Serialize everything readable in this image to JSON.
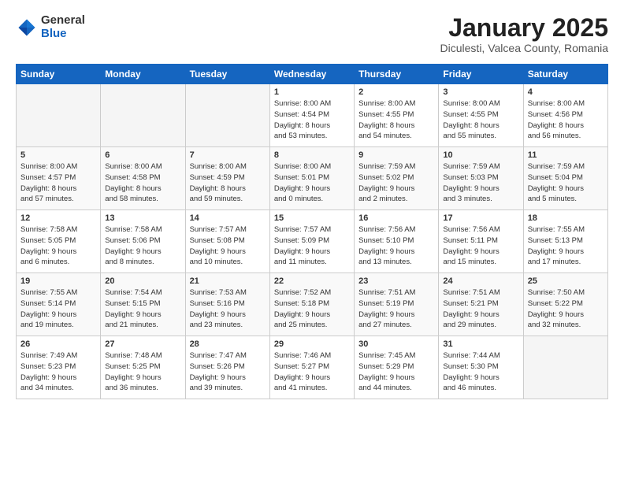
{
  "header": {
    "logo_general": "General",
    "logo_blue": "Blue",
    "title": "January 2025",
    "subtitle": "Diculesti, Valcea County, Romania"
  },
  "weekdays": [
    "Sunday",
    "Monday",
    "Tuesday",
    "Wednesday",
    "Thursday",
    "Friday",
    "Saturday"
  ],
  "weeks": [
    [
      {
        "num": "",
        "info": ""
      },
      {
        "num": "",
        "info": ""
      },
      {
        "num": "",
        "info": ""
      },
      {
        "num": "1",
        "info": "Sunrise: 8:00 AM\nSunset: 4:54 PM\nDaylight: 8 hours\nand 53 minutes."
      },
      {
        "num": "2",
        "info": "Sunrise: 8:00 AM\nSunset: 4:55 PM\nDaylight: 8 hours\nand 54 minutes."
      },
      {
        "num": "3",
        "info": "Sunrise: 8:00 AM\nSunset: 4:55 PM\nDaylight: 8 hours\nand 55 minutes."
      },
      {
        "num": "4",
        "info": "Sunrise: 8:00 AM\nSunset: 4:56 PM\nDaylight: 8 hours\nand 56 minutes."
      }
    ],
    [
      {
        "num": "5",
        "info": "Sunrise: 8:00 AM\nSunset: 4:57 PM\nDaylight: 8 hours\nand 57 minutes."
      },
      {
        "num": "6",
        "info": "Sunrise: 8:00 AM\nSunset: 4:58 PM\nDaylight: 8 hours\nand 58 minutes."
      },
      {
        "num": "7",
        "info": "Sunrise: 8:00 AM\nSunset: 4:59 PM\nDaylight: 8 hours\nand 59 minutes."
      },
      {
        "num": "8",
        "info": "Sunrise: 8:00 AM\nSunset: 5:01 PM\nDaylight: 9 hours\nand 0 minutes."
      },
      {
        "num": "9",
        "info": "Sunrise: 7:59 AM\nSunset: 5:02 PM\nDaylight: 9 hours\nand 2 minutes."
      },
      {
        "num": "10",
        "info": "Sunrise: 7:59 AM\nSunset: 5:03 PM\nDaylight: 9 hours\nand 3 minutes."
      },
      {
        "num": "11",
        "info": "Sunrise: 7:59 AM\nSunset: 5:04 PM\nDaylight: 9 hours\nand 5 minutes."
      }
    ],
    [
      {
        "num": "12",
        "info": "Sunrise: 7:58 AM\nSunset: 5:05 PM\nDaylight: 9 hours\nand 6 minutes."
      },
      {
        "num": "13",
        "info": "Sunrise: 7:58 AM\nSunset: 5:06 PM\nDaylight: 9 hours\nand 8 minutes."
      },
      {
        "num": "14",
        "info": "Sunrise: 7:57 AM\nSunset: 5:08 PM\nDaylight: 9 hours\nand 10 minutes."
      },
      {
        "num": "15",
        "info": "Sunrise: 7:57 AM\nSunset: 5:09 PM\nDaylight: 9 hours\nand 11 minutes."
      },
      {
        "num": "16",
        "info": "Sunrise: 7:56 AM\nSunset: 5:10 PM\nDaylight: 9 hours\nand 13 minutes."
      },
      {
        "num": "17",
        "info": "Sunrise: 7:56 AM\nSunset: 5:11 PM\nDaylight: 9 hours\nand 15 minutes."
      },
      {
        "num": "18",
        "info": "Sunrise: 7:55 AM\nSunset: 5:13 PM\nDaylight: 9 hours\nand 17 minutes."
      }
    ],
    [
      {
        "num": "19",
        "info": "Sunrise: 7:55 AM\nSunset: 5:14 PM\nDaylight: 9 hours\nand 19 minutes."
      },
      {
        "num": "20",
        "info": "Sunrise: 7:54 AM\nSunset: 5:15 PM\nDaylight: 9 hours\nand 21 minutes."
      },
      {
        "num": "21",
        "info": "Sunrise: 7:53 AM\nSunset: 5:16 PM\nDaylight: 9 hours\nand 23 minutes."
      },
      {
        "num": "22",
        "info": "Sunrise: 7:52 AM\nSunset: 5:18 PM\nDaylight: 9 hours\nand 25 minutes."
      },
      {
        "num": "23",
        "info": "Sunrise: 7:51 AM\nSunset: 5:19 PM\nDaylight: 9 hours\nand 27 minutes."
      },
      {
        "num": "24",
        "info": "Sunrise: 7:51 AM\nSunset: 5:21 PM\nDaylight: 9 hours\nand 29 minutes."
      },
      {
        "num": "25",
        "info": "Sunrise: 7:50 AM\nSunset: 5:22 PM\nDaylight: 9 hours\nand 32 minutes."
      }
    ],
    [
      {
        "num": "26",
        "info": "Sunrise: 7:49 AM\nSunset: 5:23 PM\nDaylight: 9 hours\nand 34 minutes."
      },
      {
        "num": "27",
        "info": "Sunrise: 7:48 AM\nSunset: 5:25 PM\nDaylight: 9 hours\nand 36 minutes."
      },
      {
        "num": "28",
        "info": "Sunrise: 7:47 AM\nSunset: 5:26 PM\nDaylight: 9 hours\nand 39 minutes."
      },
      {
        "num": "29",
        "info": "Sunrise: 7:46 AM\nSunset: 5:27 PM\nDaylight: 9 hours\nand 41 minutes."
      },
      {
        "num": "30",
        "info": "Sunrise: 7:45 AM\nSunset: 5:29 PM\nDaylight: 9 hours\nand 44 minutes."
      },
      {
        "num": "31",
        "info": "Sunrise: 7:44 AM\nSunset: 5:30 PM\nDaylight: 9 hours\nand 46 minutes."
      },
      {
        "num": "",
        "info": ""
      }
    ]
  ]
}
